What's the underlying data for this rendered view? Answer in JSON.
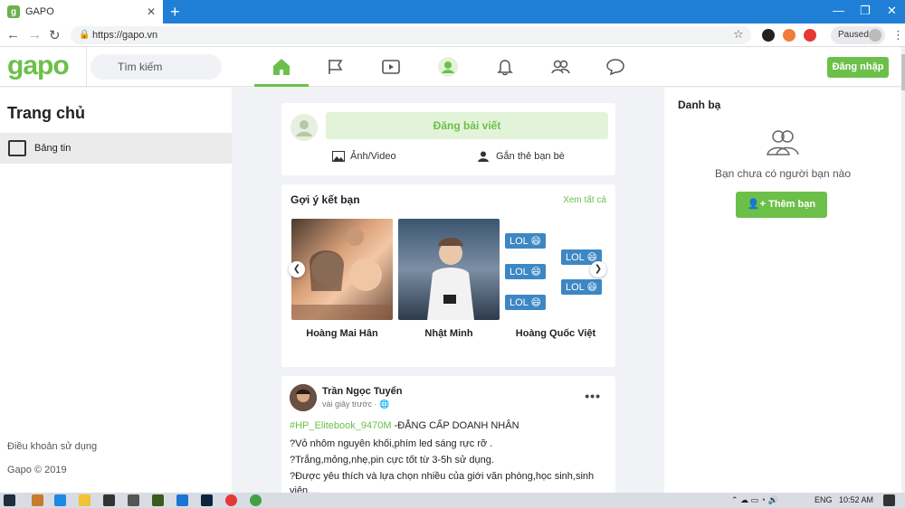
{
  "browser": {
    "tab_title": "GAPO",
    "tab_favicon": "g",
    "new_tab": "+",
    "url": "https://gapo.vn",
    "profile_status": "Paused",
    "min": "—",
    "max": "❐",
    "close": "✕"
  },
  "header": {
    "logo": "gapo",
    "search_placeholder": "Tìm kiếm",
    "login_label": "Đăng nhập",
    "nav_icons": [
      "home-icon",
      "flag-icon",
      "video-icon",
      "profile-icon",
      "bell-icon",
      "friends-icon",
      "chat-icon"
    ],
    "accent": "#6cc04a"
  },
  "sidebar": {
    "title": "Trang chủ",
    "items": [
      {
        "label": "Bảng tin"
      }
    ],
    "footer_terms": "Điều khoản sử dụng",
    "copyright": "Gapo © 2019"
  },
  "composer": {
    "post_label": "Đăng bài viết",
    "photo_video": "Ảnh/Video",
    "tag_friends": "Gắn thẻ bạn bè"
  },
  "suggestions": {
    "title": "Gợi ý kết bạn",
    "see_all": "Xem tất cả",
    "people": [
      {
        "name": "Hoàng Mai Hân"
      },
      {
        "name": "Nhật Minh"
      },
      {
        "name": "Hoàng Quốc Việt"
      }
    ],
    "lol_text": "LOL 😄"
  },
  "post": {
    "author": "Trần Ngọc Tuyển",
    "time": "vài giây trước · 🌐",
    "hashtag": "#HP_Elitebook_9470M",
    "line1_rest": " -ĐẲNG CẤP DOANH NHÂN",
    "line2": "?Vỏ nhôm nguyên khối,phím led sáng rực rỡ .",
    "line3": "?Trắng,mỏng,nhẹ,pin cực tốt từ 3-5h sử dụng.",
    "line4": "?Được yêu thích và lựa chọn nhiều của giới văn phòng,học sinh,sinh",
    "line5": "viên,...",
    "more": "•••"
  },
  "contacts": {
    "title": "Danh bạ",
    "empty_text": "Bạn chưa có người bạn nào",
    "add_friend": "Thêm bạn"
  },
  "taskbar": {
    "lang": "ENG",
    "time": "10:52 AM"
  }
}
